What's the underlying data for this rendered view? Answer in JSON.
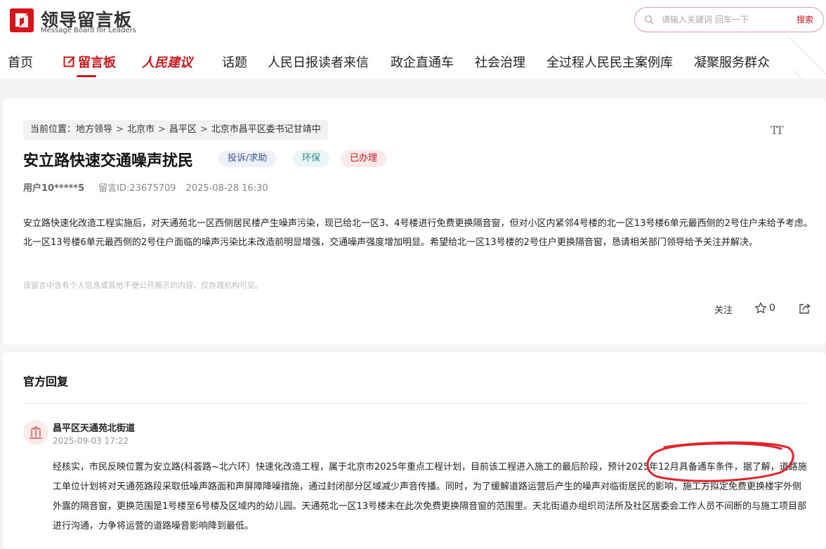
{
  "header": {
    "logo_title": "领导留言板",
    "logo_subtitle": "Message Board for Leaders",
    "search": {
      "placeholder": "请输入关键词 回车一下",
      "button_label": "搜索"
    },
    "nav": [
      {
        "label": "首页"
      },
      {
        "label": "留言板"
      },
      {
        "label": "人民建议"
      },
      {
        "label": "话题"
      },
      {
        "label": "人民日报读者来信"
      },
      {
        "label": "政企直通车"
      },
      {
        "label": "社会治理"
      },
      {
        "label": "全过程人民民主案例库"
      },
      {
        "label": "凝聚服务群众"
      }
    ]
  },
  "message": {
    "breadcrumb": {
      "prefix": "当前位置：",
      "items": [
        "地方领导",
        "北京市",
        "昌平区",
        "北京市昌平区委书记甘靖中"
      ]
    },
    "font_toggle": "TT",
    "title": "安立路快速交通噪声扰民",
    "tags": {
      "type": "投诉/求助",
      "category": "环保",
      "status": "已办理"
    },
    "user": "用户10*****5",
    "message_id": "留言ID:23675709",
    "datetime": "2025-08-28 16:30",
    "body": "安立路快速化改造工程实施后，对天通苑北一区西侧居民楼产生噪声污染，现已给北一区3、4号楼进行免费更换隔音窗，但对小区内紧邻4号楼的北一区13号楼6单元最西侧的2号住户未给予考虑。北一区13号楼6单元最西侧的2号住户面临的噪声污染比未改造前明显增强，交通噪声强度增加明显。希望给北一区13号楼的2号住户更换隔音窗，恳请相关部门领导给予关注并解决。",
    "privacy_note": "该留言中含有个人信息或其他不便公开展示的内容，仅办理机构可见。",
    "actions": {
      "follow_label": "关注",
      "like_count": "0"
    }
  },
  "reply": {
    "heading": "官方回复",
    "org_name": "昌平区天通苑北街道",
    "time": "2025-09-03 17:22",
    "body_before": "经核实，市民反映位置为安立路(科荟路~北六环）快速化改造工程，属于北京市2025年重点工程计划，目前该工程进入施工的最后阶段，",
    "body_highlight": "预计2025年12月具备通车条件",
    "body_after": "，据了解，道路施工单位计划将对天通苑路段采取低噪声路面和声屏障降噪措施，通过封闭部分区域减少声音传播。同时，为了缓解道路运营后产生的噪声对临街居民的影响，施工方拟定免费更换楼宇外侧外露的隔音窗，更换范围是1号楼至6号楼及区域内的幼儿园。天通苑北一区13号楼未在此次免费更换隔音窗的范围里。天北街道办组织司法所及社区居委会工作人员不间断的与施工项目部进行沟通，力争将运营的道路噪音影响降到最低。"
  },
  "colors": {
    "brand_red": "#c9171e",
    "annotation_red": "#e0242c"
  }
}
